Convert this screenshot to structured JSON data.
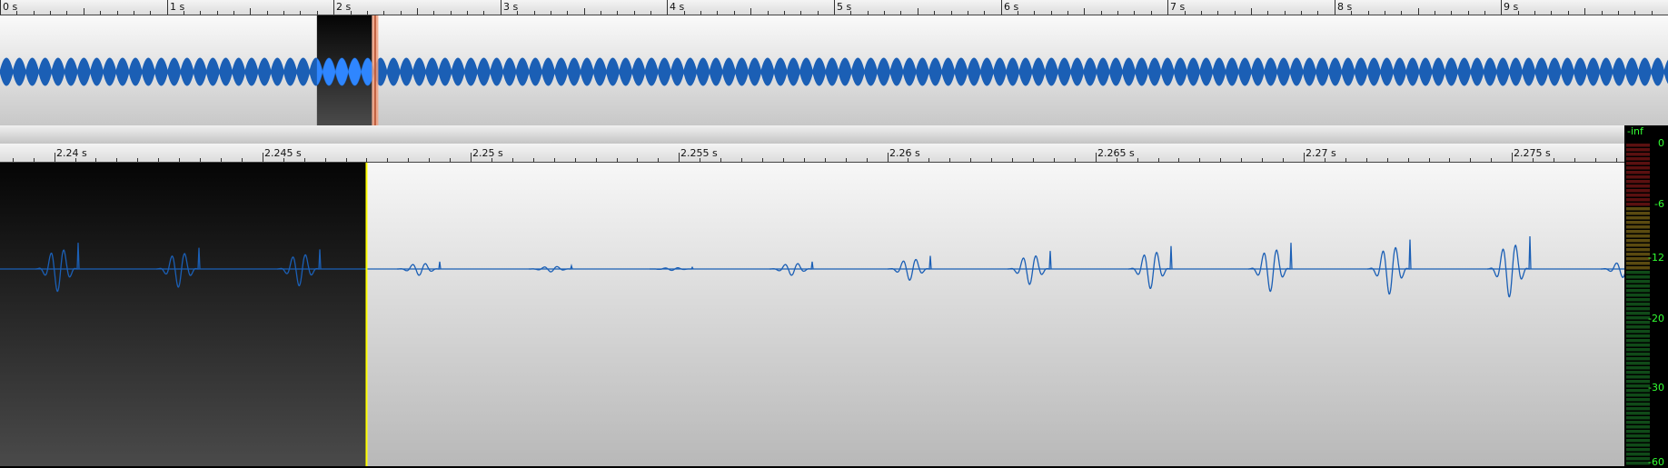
{
  "overview": {
    "ruler_labels": [
      "0 s",
      "1 s",
      "2 s",
      "3 s",
      "4 s",
      "5 s",
      "6 s",
      "7 s",
      "8 s",
      "9 s"
    ],
    "selection_start_s": 1.9,
    "selection_end_s": 2.23,
    "playhead_s": 2.265,
    "duration_s": 10.0
  },
  "detail": {
    "ruler_labels": [
      "2.24 s",
      "2.245 s",
      "2.25 s",
      "2.255 s",
      "2.26 s",
      "2.265 s",
      "2.27 s",
      "2.275 s"
    ],
    "range_start_s": 2.2387,
    "range_end_s": 2.2777,
    "selection_end_s": 2.2475
  },
  "meter": {
    "labels": [
      "-inf",
      "0",
      "-6",
      "-12",
      "-20",
      "-30",
      "-60"
    ]
  },
  "colors": {
    "waveform": "#1b5fb5",
    "waveform_bright": "#2f86ff",
    "cursor": "#ffff00",
    "playhead": "#f0a080",
    "meter_text": "#33ff33"
  }
}
